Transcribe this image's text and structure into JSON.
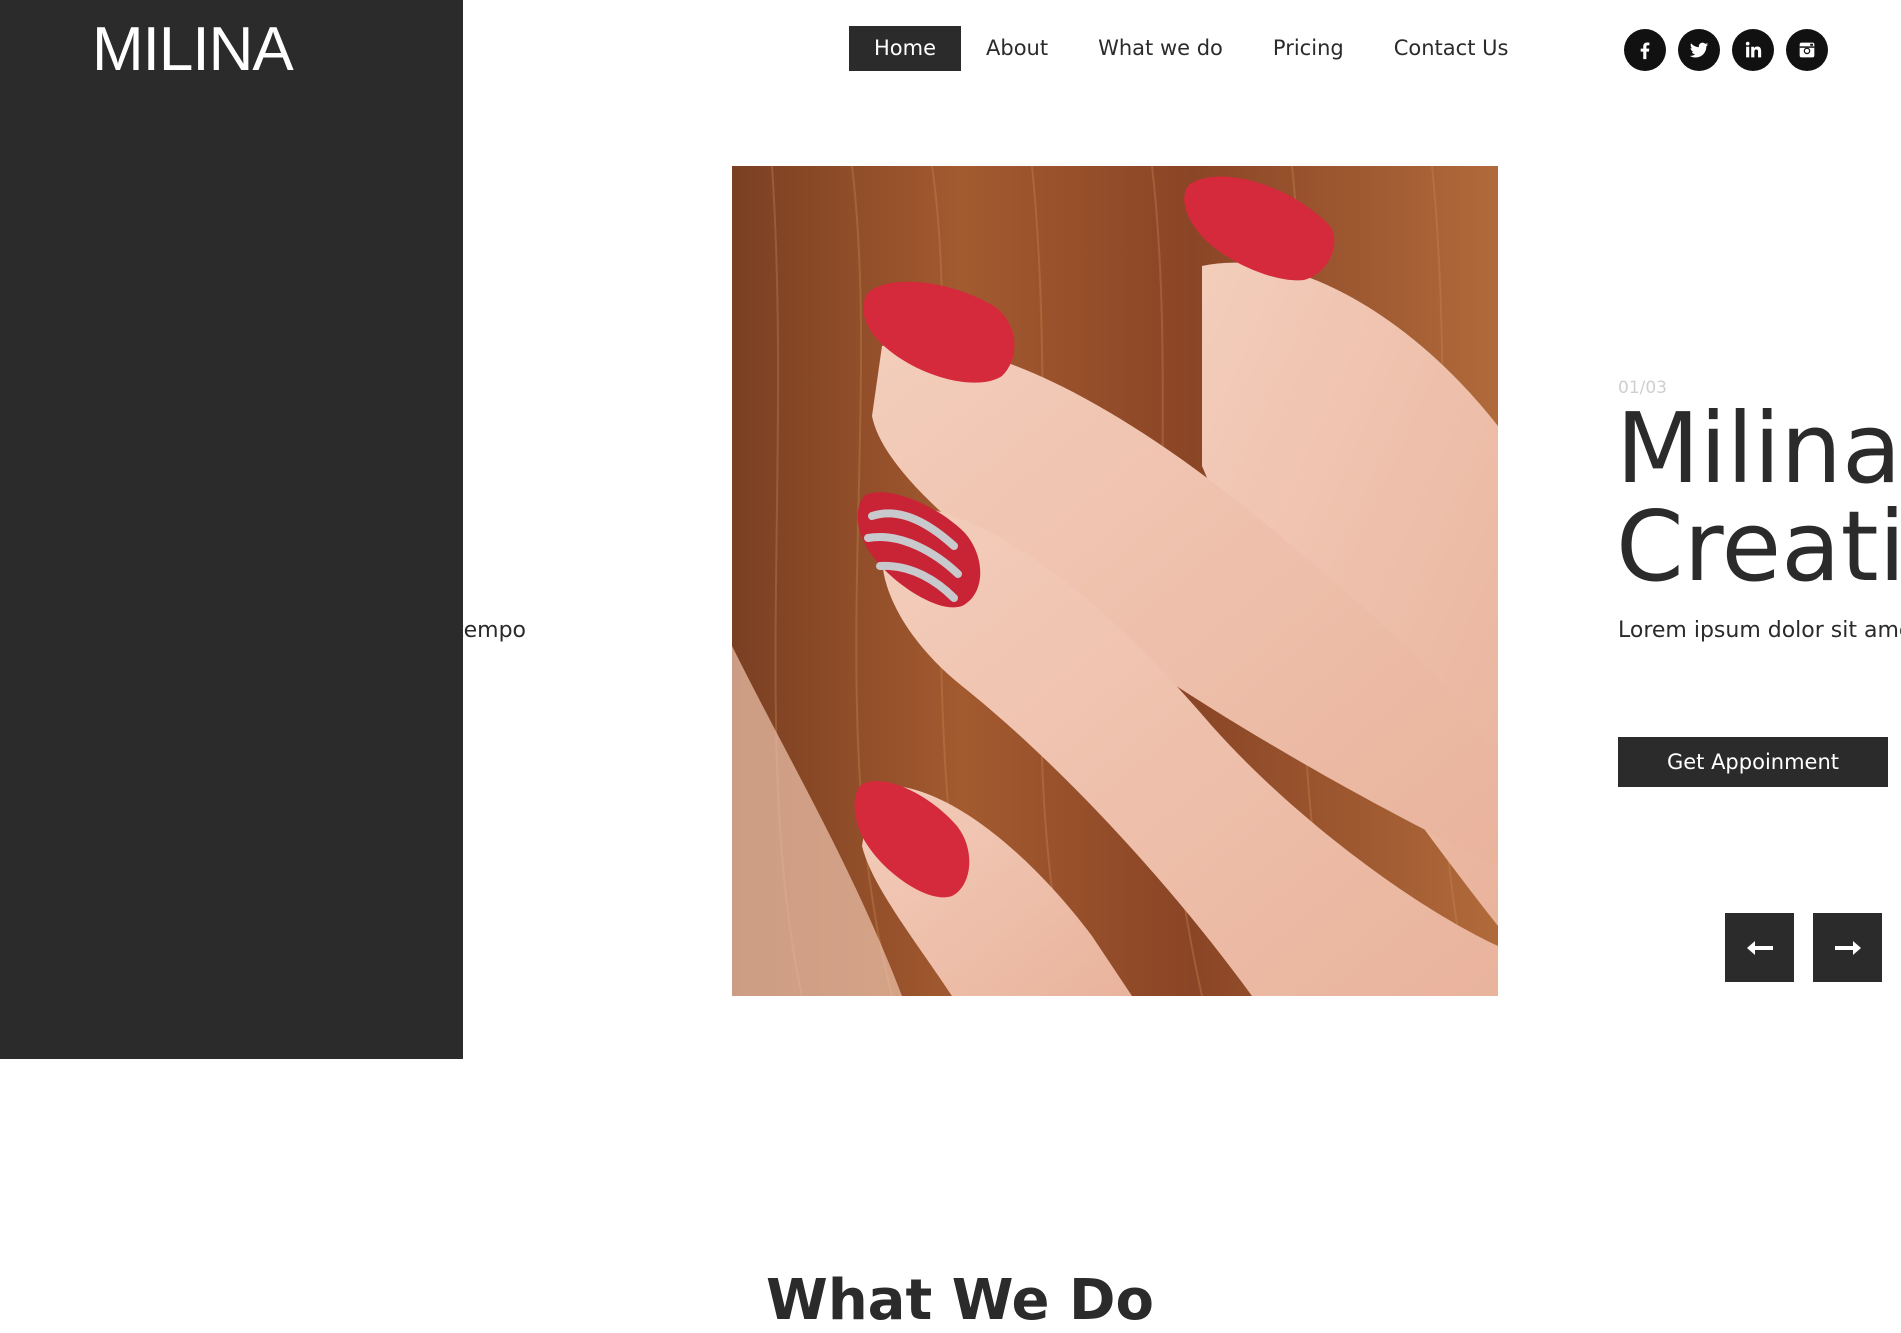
{
  "brand": {
    "logo": "MILINA"
  },
  "nav": {
    "items": [
      {
        "label": "Home",
        "active": true
      },
      {
        "label": "About"
      },
      {
        "label": "What we do"
      },
      {
        "label": "Pricing"
      },
      {
        "label": "Contact Us"
      }
    ]
  },
  "social": {
    "icons": [
      "facebook-icon",
      "twitter-icon",
      "linkedin-icon",
      "instagram-icon"
    ]
  },
  "hero": {
    "previous_slide_text_fragment": "tempo",
    "counter": "01/03",
    "title_line1": "Milina",
    "title_line2": "Creati",
    "text": "Lorem ipsum dolor sit amet",
    "cta_label": "Get Appoinment",
    "image_alt": "manicured red nails in brown hair"
  },
  "slider_controls": {
    "prev_icon": "arrow-left-icon",
    "next_icon": "arrow-right-icon"
  },
  "section": {
    "heading": "What We Do"
  },
  "colors": {
    "dark": "#2b2b2b",
    "nail_red": "#d42a3c",
    "white": "#ffffff"
  }
}
